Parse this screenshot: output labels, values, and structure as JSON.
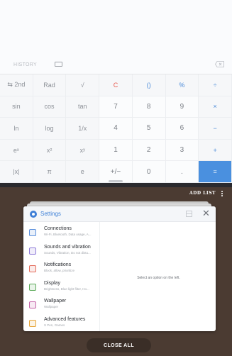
{
  "calculator": {
    "history_label": "HISTORY",
    "keys": [
      {
        "label": "⇆ 2nd",
        "kind": "fn"
      },
      {
        "label": "Rad",
        "kind": "fn"
      },
      {
        "label": "√",
        "kind": "fn"
      },
      {
        "label": "C",
        "kind": "c"
      },
      {
        "label": "()",
        "kind": "op"
      },
      {
        "label": "%",
        "kind": "op"
      },
      {
        "label": "÷",
        "kind": "op"
      },
      {
        "label": "sin",
        "kind": "fn"
      },
      {
        "label": "cos",
        "kind": "fn"
      },
      {
        "label": "tan",
        "kind": "fn"
      },
      {
        "label": "7",
        "kind": "num"
      },
      {
        "label": "8",
        "kind": "num"
      },
      {
        "label": "9",
        "kind": "num"
      },
      {
        "label": "×",
        "kind": "op"
      },
      {
        "label": "ln",
        "kind": "fn"
      },
      {
        "label": "log",
        "kind": "fn"
      },
      {
        "label": "1/x",
        "kind": "fn"
      },
      {
        "label": "4",
        "kind": "num"
      },
      {
        "label": "5",
        "kind": "num"
      },
      {
        "label": "6",
        "kind": "num"
      },
      {
        "label": "−",
        "kind": "op"
      },
      {
        "label": "eˣ",
        "kind": "fn"
      },
      {
        "label": "x²",
        "kind": "fn"
      },
      {
        "label": "xʸ",
        "kind": "fn"
      },
      {
        "label": "1",
        "kind": "num"
      },
      {
        "label": "2",
        "kind": "num"
      },
      {
        "label": "3",
        "kind": "num"
      },
      {
        "label": "+",
        "kind": "op"
      },
      {
        "label": "|x|",
        "kind": "fn"
      },
      {
        "label": "π",
        "kind": "fn"
      },
      {
        "label": "e",
        "kind": "fn"
      },
      {
        "label": "+/−",
        "kind": "num"
      },
      {
        "label": "0",
        "kind": "num"
      },
      {
        "label": ".",
        "kind": "num"
      },
      {
        "label": "=",
        "kind": "eq"
      }
    ]
  },
  "recents": {
    "add_list_label": "ADD LIST",
    "close_all_label": "CLOSE ALL"
  },
  "settings": {
    "title": "Settings",
    "empty_message": "Select an option on the left.",
    "items": [
      {
        "title": "Connections",
        "subtitle": "Wi-Fi, Bluetooth, Data usage, A...",
        "icon": "connections-icon",
        "color": "#5b8fdc"
      },
      {
        "title": "Sounds and vibration",
        "subtitle": "Sounds, Vibration, Do not distu...",
        "icon": "sound-icon",
        "color": "#8e7ad8"
      },
      {
        "title": "Notifications",
        "subtitle": "Block, allow, prioritize",
        "icon": "notifications-icon",
        "color": "#e46c5c"
      },
      {
        "title": "Display",
        "subtitle": "Brightness, Blue light filter, Ho...",
        "icon": "display-icon",
        "color": "#5daa5a"
      },
      {
        "title": "Wallpaper",
        "subtitle": "Wallpaper",
        "icon": "wallpaper-icon",
        "color": "#c464a8"
      },
      {
        "title": "Advanced features",
        "subtitle": "S Pen, Games",
        "icon": "advanced-features-icon",
        "color": "#e6a437"
      }
    ]
  }
}
